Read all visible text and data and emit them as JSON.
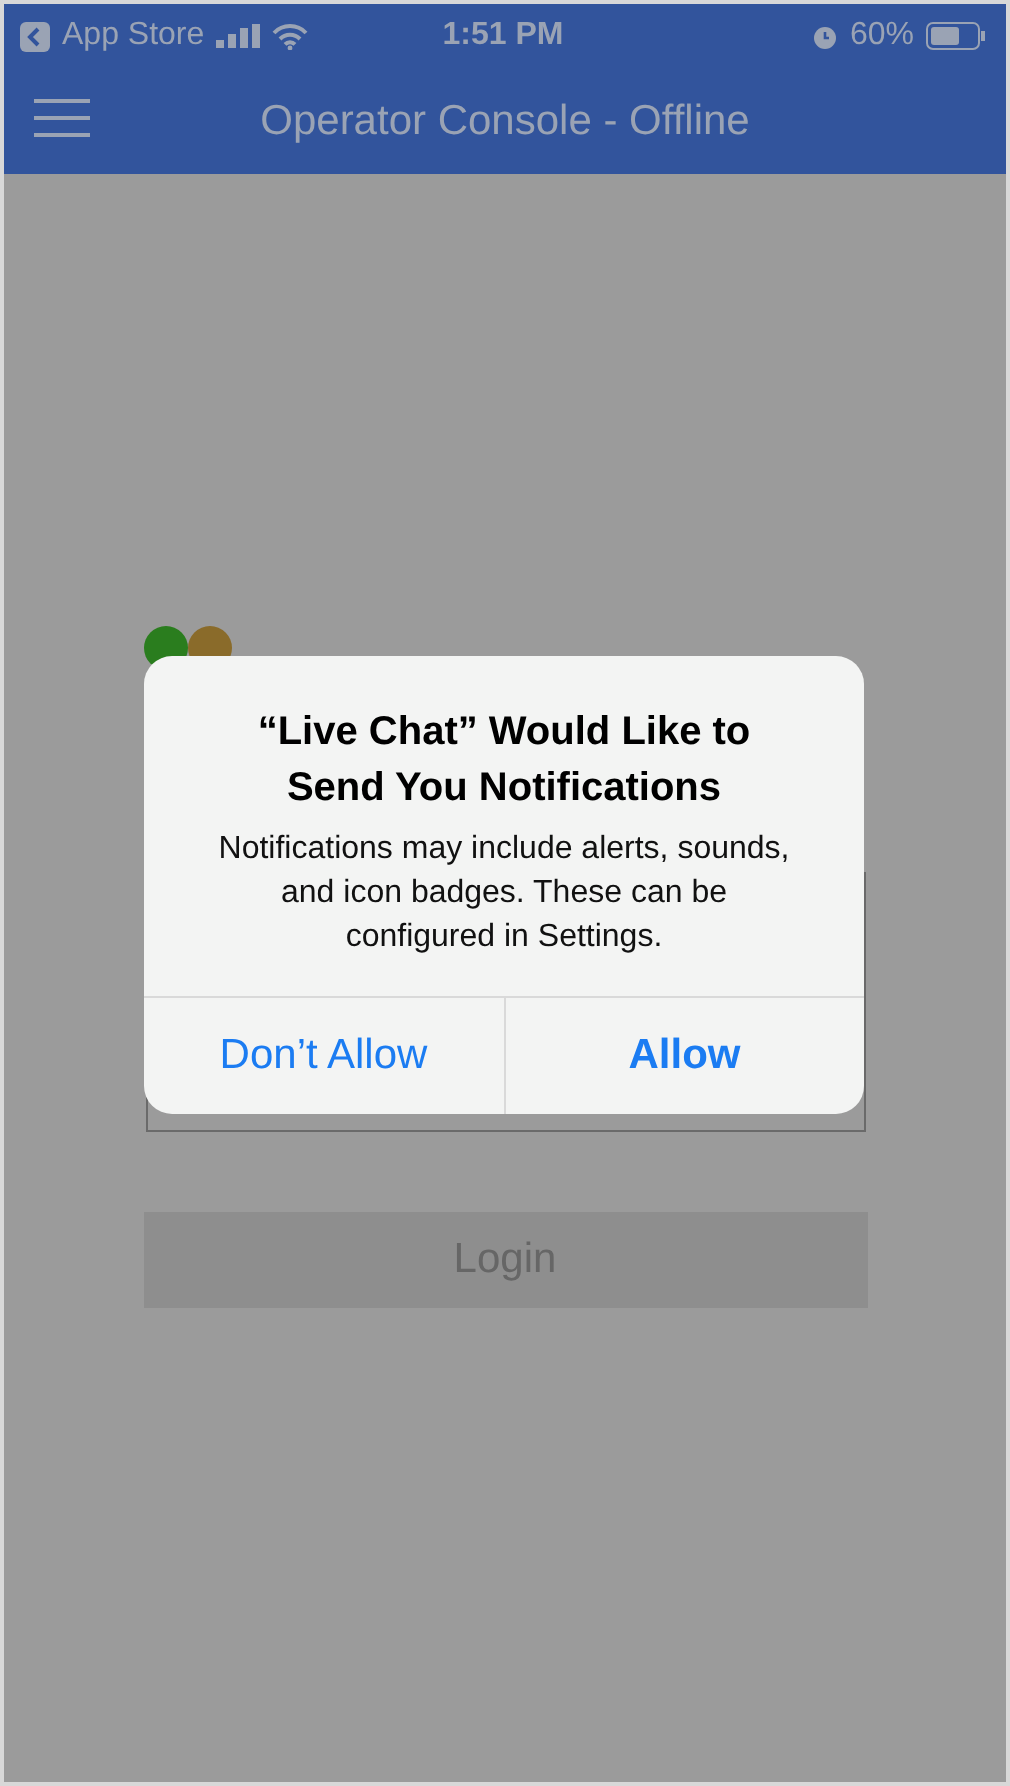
{
  "status_bar": {
    "back_label": "App Store",
    "time": "1:51 PM",
    "battery": "60%"
  },
  "nav_bar": {
    "title": "Operator Console - Offline"
  },
  "login": {
    "button": "Login"
  },
  "alert": {
    "title": "“Live Chat” Would Like to Send You Notifications",
    "message": "Notifications may include alerts, sounds, and icon badges. These can be configured in Settings.",
    "buttons": [
      {
        "label": "Don’t Allow",
        "kind": "cancel"
      },
      {
        "label": "Allow",
        "kind": "default"
      }
    ]
  }
}
